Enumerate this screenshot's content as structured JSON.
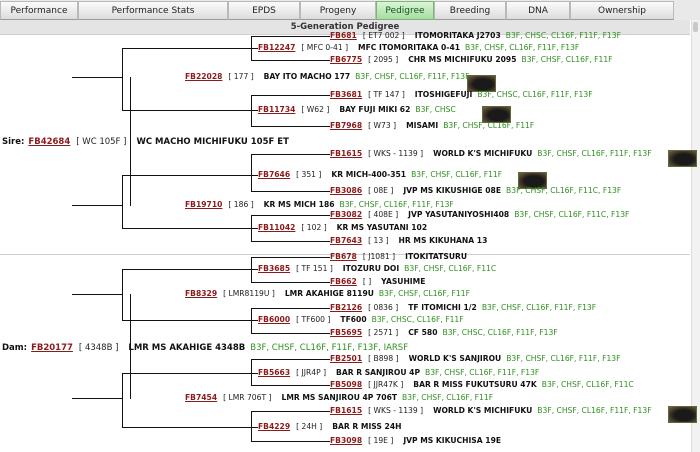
{
  "tabs": [
    "Performance",
    "Performance Stats",
    "EPDS",
    "Progeny",
    "Pedigree",
    "Breeding",
    "DNA",
    "Ownership"
  ],
  "active_tab": "Pedigree",
  "heading": "5-Generation Pedigree",
  "sire_label": "Sire:",
  "dam_label": "Dam:",
  "sire": {
    "id": "FB42684",
    "code": "[ WC 105F ]",
    "name": "WC MACHO MICHIFUKU 105F ET",
    "tags": ""
  },
  "dam": {
    "id": "FB20177",
    "code": "[ 4348B ]",
    "name": "LMR MS AKAHIGE 4348B",
    "tags": "B3F, CHSF, CL16F, F11F, F13F, IARSF"
  },
  "nodes": [
    {
      "id": "FB681",
      "code": "[ ET7 002 ]",
      "name": "ITOMORITAKA J2703",
      "tags": "B3F, CHSC, CL16F, F11F, F13F"
    },
    {
      "id": "FB12247",
      "code": "[ MFC 0-41 ]",
      "name": "MFC ITOMORITAKA 0-41",
      "tags": "B3F, CHSF, CL16F, F11F, F13F"
    },
    {
      "id": "FB6775",
      "code": "[ 2095 ]",
      "name": "CHR MS MICHIFUKU 2095",
      "tags": "B3F, CHSF, CL16F, F11F"
    },
    {
      "id": "FB22028",
      "code": "[ 177 ]",
      "name": "BAY ITO MACHO 177",
      "tags": "B3F, CHSF, CL16F, F11F, F13F"
    },
    {
      "id": "FB3681",
      "code": "[ TF 147 ]",
      "name": "ITOSHIGEFUJI",
      "tags": "B3F, CHSC, CL16F, F11F, F13F"
    },
    {
      "id": "FB11734",
      "code": "[ W62 ]",
      "name": "BAY FUJI MIKI 62",
      "tags": "B3F, CHSC"
    },
    {
      "id": "FB7968",
      "code": "[ W73 ]",
      "name": "MISAMI",
      "tags": "B3F, CHSF, CL16F, F11F"
    },
    {
      "id": "FB1615",
      "code": "[ WKS - 1139 ]",
      "name": "WORLD K'S MICHIFUKU",
      "tags": "B3F, CHSF, CL16F, F11F, F13F"
    },
    {
      "id": "FB7646",
      "code": "[ 351 ]",
      "name": "KR MICH-400-351",
      "tags": "B3F, CHSF, CL16F, F11F"
    },
    {
      "id": "FB3086",
      "code": "[ 08E ]",
      "name": "JVP MS KIKUSHIGE 08E",
      "tags": "B3F, CHSF, CL16F, F11C, F13F"
    },
    {
      "id": "FB19710",
      "code": "[ 186 ]",
      "name": "KR MS MICH 186",
      "tags": "B3F, CHSF, CL16F, F11F, F13F"
    },
    {
      "id": "FB3082",
      "code": "[ 408E ]",
      "name": "JVP YASUTANIYOSHI408",
      "tags": "B3F, CHSF, CL16F, F11C, F13F"
    },
    {
      "id": "FB11042",
      "code": "[ 102 ]",
      "name": "KR MS YASUTANI 102",
      "tags": ""
    },
    {
      "id": "FB7643",
      "code": "[ 13 ]",
      "name": "HR MS KIKUHANA 13",
      "tags": ""
    },
    {
      "id": "FB678",
      "code": "[ J1081 ]",
      "name": "ITOKITATSURU",
      "tags": ""
    },
    {
      "id": "FB3685",
      "code": "[ TF 151 ]",
      "name": "ITOZURU DOI",
      "tags": "B3F, CHSF, CL16F, F11C"
    },
    {
      "id": "FB662",
      "code": "[ ]",
      "name": "YASUHIME",
      "tags": ""
    },
    {
      "id": "FB8329",
      "code": "[ LMR8119U ]",
      "name": "LMR AKAHIGE 8119U",
      "tags": "B3F, CHSF, CL16F, F11F"
    },
    {
      "id": "FB2126",
      "code": "[ 0836 ]",
      "name": "TF ITOMICHI 1/2",
      "tags": "B3F, CHSF, CL16F, F11F, F13F"
    },
    {
      "id": "FB6000",
      "code": "[ TF600 ]",
      "name": "TF600",
      "tags": "B3F, CHSC, CL16F, F11F"
    },
    {
      "id": "FB5695",
      "code": "[ 2571 ]",
      "name": "CF 580",
      "tags": "B3F, CHSC, CL16F, F11F, F13F"
    },
    {
      "id": "FB2501",
      "code": "[ B898 ]",
      "name": "WORLD K'S SANJIROU",
      "tags": "B3F, CHSF, CL16F, F11F, F13F"
    },
    {
      "id": "FB5663",
      "code": "[ JJR4P ]",
      "name": "BAR R SANJIROU 4P",
      "tags": "B3F, CHSF, CL16F, F11F, F13F"
    },
    {
      "id": "FB5098",
      "code": "[ JJR47K ]",
      "name": "BAR R MISS FUKUTSURU 47K",
      "tags": "B3F, CHSF, CL16F, F11C"
    },
    {
      "id": "FB7454",
      "code": "[ LMR 706T ]",
      "name": "LMR MS SANJIROU 4P 706T",
      "tags": "B3F, CHSF, CL16F, F11F"
    },
    {
      "id": "FB1615",
      "code": "[ WKS - 1139 ]",
      "name": "WORLD K'S MICHIFUKU",
      "tags": "B3F, CHSF, CL16F, F11F, F13F"
    },
    {
      "id": "FB4229",
      "code": "[ 24H ]",
      "name": "BAR R MISS 24H",
      "tags": ""
    },
    {
      "id": "FB3098",
      "code": "[ 19E ]",
      "name": "JVP MS KIKUCHISA 19E",
      "tags": ""
    }
  ],
  "colors": {
    "id_link": "#8b1a1a",
    "tags": "#2f8f1f",
    "active_tab": "#a7dca2"
  }
}
